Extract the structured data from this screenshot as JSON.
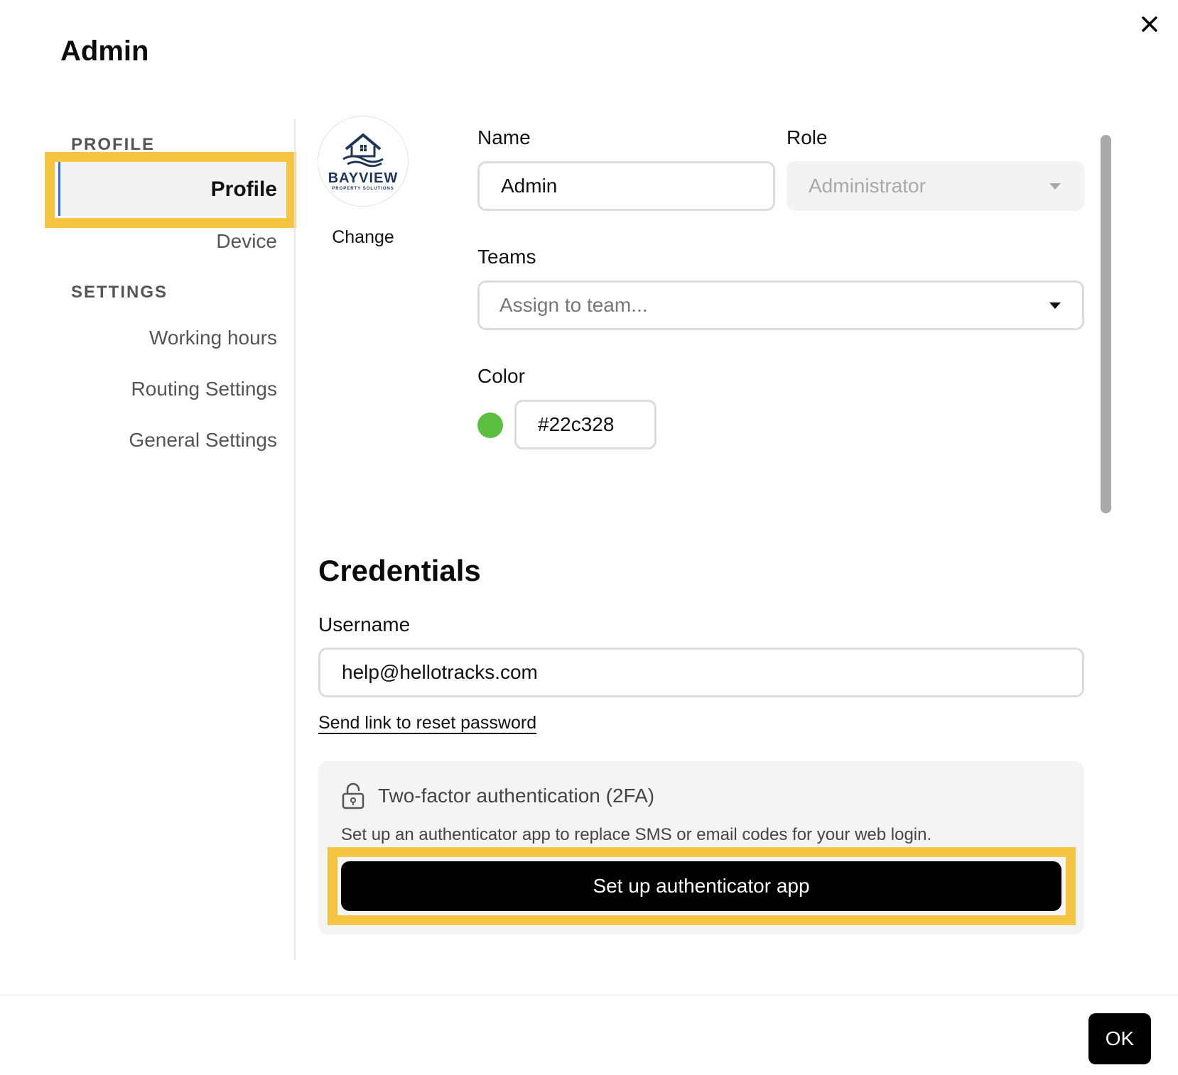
{
  "dialog": {
    "title": "Admin",
    "close_icon": "close-icon",
    "ok_label": "OK"
  },
  "sidebar": {
    "profile_section_label": "PROFILE",
    "settings_section_label": "SETTINGS",
    "items": [
      {
        "label": "Profile",
        "active": true
      },
      {
        "label": "Device",
        "active": false
      },
      {
        "label": "Working hours",
        "active": false
      },
      {
        "label": "Routing Settings",
        "active": false
      },
      {
        "label": "General Settings",
        "active": false
      }
    ]
  },
  "avatar": {
    "logo_text": "BAYVIEW",
    "logo_subtext": "PROPERTY SOLUTIONS",
    "change_label": "Change"
  },
  "form": {
    "name_label": "Name",
    "name_value": "Admin",
    "role_label": "Role",
    "role_value": "Administrator",
    "teams_label": "Teams",
    "teams_placeholder": "Assign to team...",
    "color_label": "Color",
    "color_value": "#22c328"
  },
  "credentials": {
    "heading": "Credentials",
    "username_label": "Username",
    "username_value": "help@hellotracks.com",
    "reset_link_label": "Send link to reset password"
  },
  "two_factor": {
    "icon": "lock-icon",
    "title": "Two-factor authentication (2FA)",
    "description": "Set up an authenticator app to replace SMS or email codes for your web login.",
    "button_label": "Set up authenticator app"
  },
  "colors": {
    "highlight": "#f5c542",
    "active_indicator": "#3b6fd8",
    "swatch": "#5bbf40"
  }
}
